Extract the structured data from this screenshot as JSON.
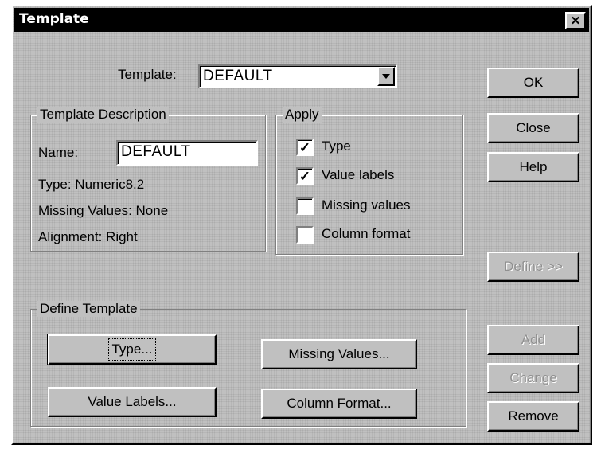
{
  "window": {
    "title": "Template"
  },
  "template_selector": {
    "label": "Template:",
    "value": "DEFAULT"
  },
  "description": {
    "group_label": "Template Description",
    "name_label": "Name:",
    "name_value": "DEFAULT",
    "type_text": "Type:   Numeric8.2",
    "missing_text": "Missing Values:   None",
    "alignment_text": "Alignment:   Right"
  },
  "apply": {
    "group_label": "Apply",
    "items": [
      {
        "label": "Type",
        "checked": true
      },
      {
        "label": "Value labels",
        "checked": true
      },
      {
        "label": "Missing values",
        "checked": false
      },
      {
        "label": "Column format",
        "checked": false
      }
    ]
  },
  "side_buttons": {
    "ok": "OK",
    "close": "Close",
    "help": "Help",
    "define": "Define >>",
    "add": "Add",
    "change": "Change",
    "remove": "Remove"
  },
  "define_template": {
    "group_label": "Define Template",
    "type_button": "Type...",
    "missing_button": "Missing Values...",
    "value_labels_button": "Value Labels...",
    "column_format_button": "Column Format..."
  }
}
